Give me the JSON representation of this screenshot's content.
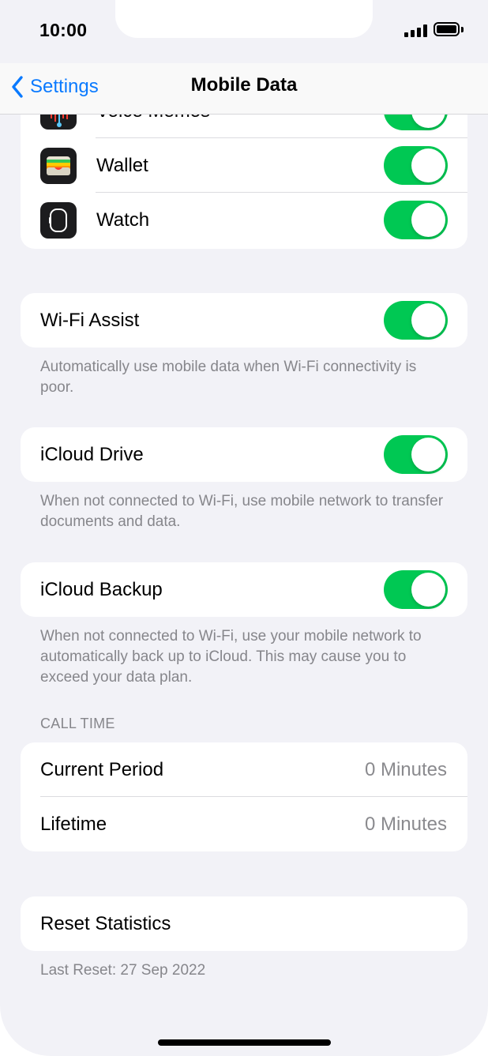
{
  "status_bar": {
    "time": "10:00",
    "signal_icon": "cellular-signal-icon",
    "battery_icon": "battery-icon"
  },
  "nav": {
    "back_label": "Settings",
    "title": "Mobile Data"
  },
  "apps": [
    {
      "label": "Voice Memos",
      "icon": "voice-memos-icon",
      "enabled": true
    },
    {
      "label": "Wallet",
      "icon": "wallet-icon",
      "enabled": true
    },
    {
      "label": "Watch",
      "icon": "watch-icon",
      "enabled": true
    }
  ],
  "wifi_assist": {
    "label": "Wi-Fi Assist",
    "enabled": true,
    "footer": "Automatically use mobile data when Wi-Fi connectivity is poor."
  },
  "icloud_drive": {
    "label": "iCloud Drive",
    "enabled": true,
    "footer": "When not connected to Wi-Fi, use mobile network to transfer documents and data."
  },
  "icloud_backup": {
    "label": "iCloud Backup",
    "enabled": true,
    "footer": "When not connected to Wi-Fi, use your mobile network to automatically back up to iCloud. This may cause you to exceed your data plan."
  },
  "call_time": {
    "header": "CALL TIME",
    "rows": [
      {
        "label": "Current Period",
        "value": "0 Minutes"
      },
      {
        "label": "Lifetime",
        "value": "0 Minutes"
      }
    ]
  },
  "reset": {
    "label": "Reset Statistics",
    "footer": "Last Reset: 27 Sep 2022"
  },
  "colors": {
    "accent": "#0a7aff",
    "toggle_on": "#00c853",
    "background": "#f2f2f7"
  }
}
